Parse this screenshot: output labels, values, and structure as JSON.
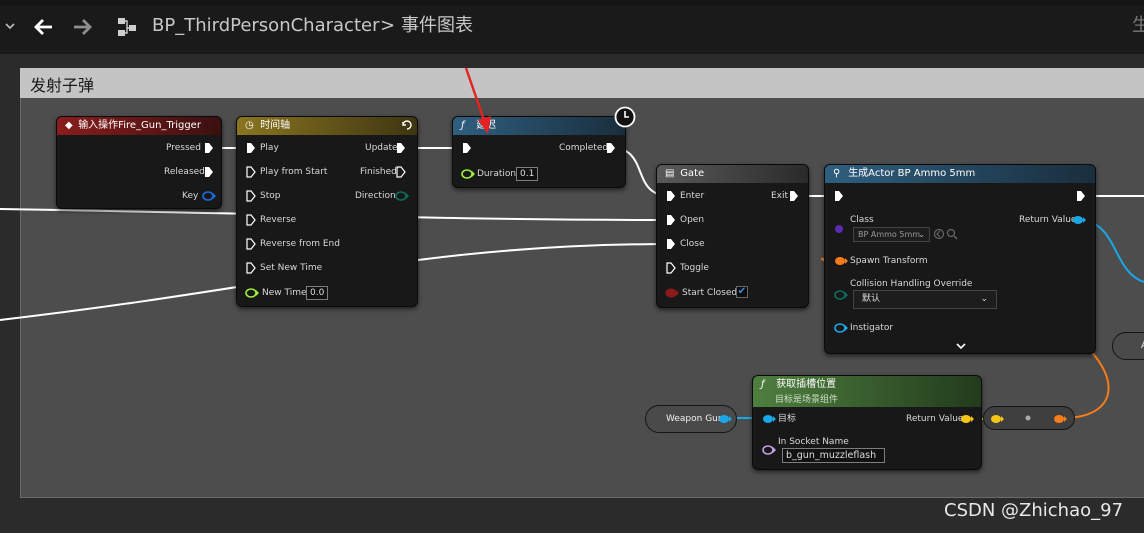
{
  "topbar": {
    "title": "BP_ThirdPersonCharacter",
    "separator": ">",
    "graph_name": "事件图表",
    "edge_char": "生"
  },
  "comment": {
    "title": "发射子弹"
  },
  "nodes": {
    "input_action": {
      "title": "输入操作Fire_Gun_Trigger",
      "pressed": "Pressed",
      "released": "Released",
      "key": "Key"
    },
    "timeline": {
      "title": "时间轴",
      "play": "Play",
      "play_from_start": "Play from Start",
      "stop": "Stop",
      "reverse": "Reverse",
      "reverse_from_end": "Reverse from End",
      "set_new_time": "Set New Time",
      "new_time": "New Time",
      "new_time_value": "0.0",
      "update": "Update",
      "finished": "Finished",
      "direction": "Direction"
    },
    "delay": {
      "title": "延迟",
      "completed": "Completed",
      "duration": "Duration",
      "duration_value": "0.1"
    },
    "gate": {
      "title": "Gate",
      "enter": "Enter",
      "open": "Open",
      "close": "Close",
      "toggle": "Toggle",
      "start_closed": "Start Closed",
      "exit": "Exit",
      "start_closed_checked": true
    },
    "spawn": {
      "title": "生成Actor BP Ammo 5mm",
      "class": "Class",
      "class_value": "BP Ammo 5mm",
      "return_value": "Return Value",
      "spawn_transform": "Spawn Transform",
      "collision": "Collision Handling Override",
      "collision_value": "默认",
      "instigator": "Instigator"
    },
    "socket": {
      "title": "获取插槽位置",
      "subtitle": "目标是场景组件",
      "target": "目标",
      "socket_name": "In Socket Name",
      "socket_value": "b_gun_muzzleflash",
      "return_value": "Return Value"
    },
    "weapon_gun": {
      "label": "Weapon Gun"
    },
    "cutoff": {
      "label": "A"
    }
  },
  "colors": {
    "exec": "#ffffff",
    "float": "#9ef23e",
    "object": "#1aa7e8",
    "class": "#5c2bb0",
    "transform": "#f57c1a",
    "vector": "#f5c518",
    "name": "#c79ee8",
    "bool": "#8b1a1a",
    "input_header": "#8a1d1d",
    "timeline_header": "#8a7520",
    "function_header": "#2f5f7f",
    "pure_header": "#4f7f3f",
    "macro_header": "#555555",
    "arrow": "#e52222"
  },
  "watermark": "CSDN @Zhichao_97"
}
